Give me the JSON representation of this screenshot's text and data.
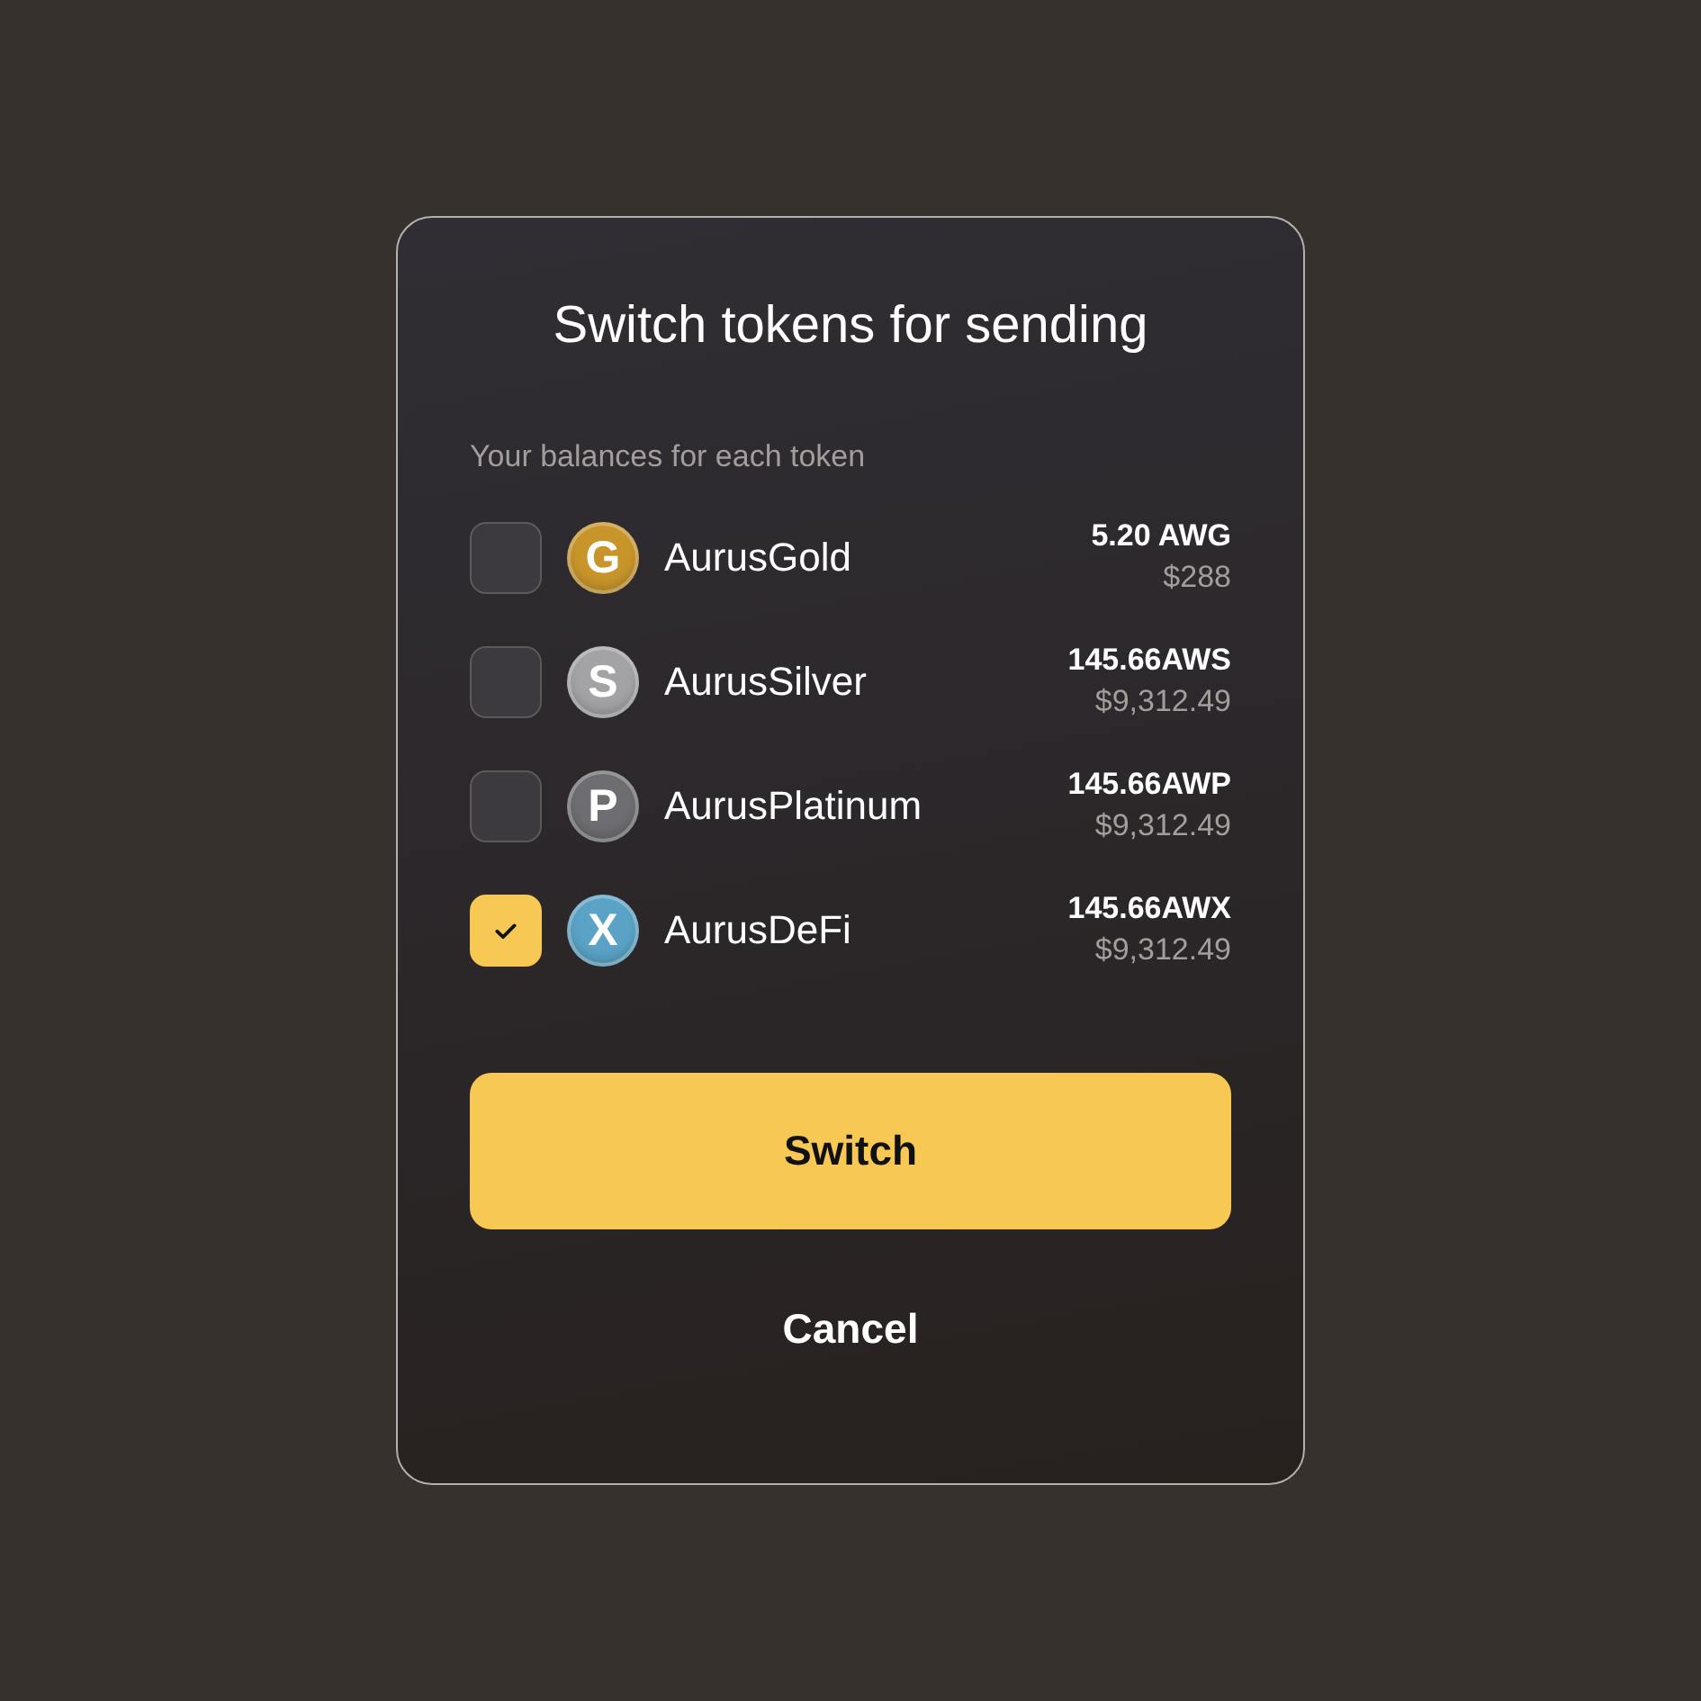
{
  "dialog": {
    "title": "Switch tokens for sending",
    "subtitle": "Your balances for each token"
  },
  "tokens": [
    {
      "name": "AurusGold",
      "logo_letter": "G",
      "color": "#c8952a",
      "amount": "5.20 AWG",
      "value": "$288",
      "checked": false
    },
    {
      "name": "AurusSilver",
      "logo_letter": "S",
      "color": "#a3a3a5",
      "amount": "145.66AWS",
      "value": "$9,312.49",
      "checked": false
    },
    {
      "name": "AurusPlatinum",
      "logo_letter": "P",
      "color": "#6e6e72",
      "amount": "145.66AWP",
      "value": "$9,312.49",
      "checked": false
    },
    {
      "name": "AurusDeFi",
      "logo_letter": "X",
      "color": "#5aa3c6",
      "amount": "145.66AWX",
      "value": "$9,312.49",
      "checked": true
    }
  ],
  "buttons": {
    "primary": "Switch",
    "secondary": "Cancel"
  }
}
